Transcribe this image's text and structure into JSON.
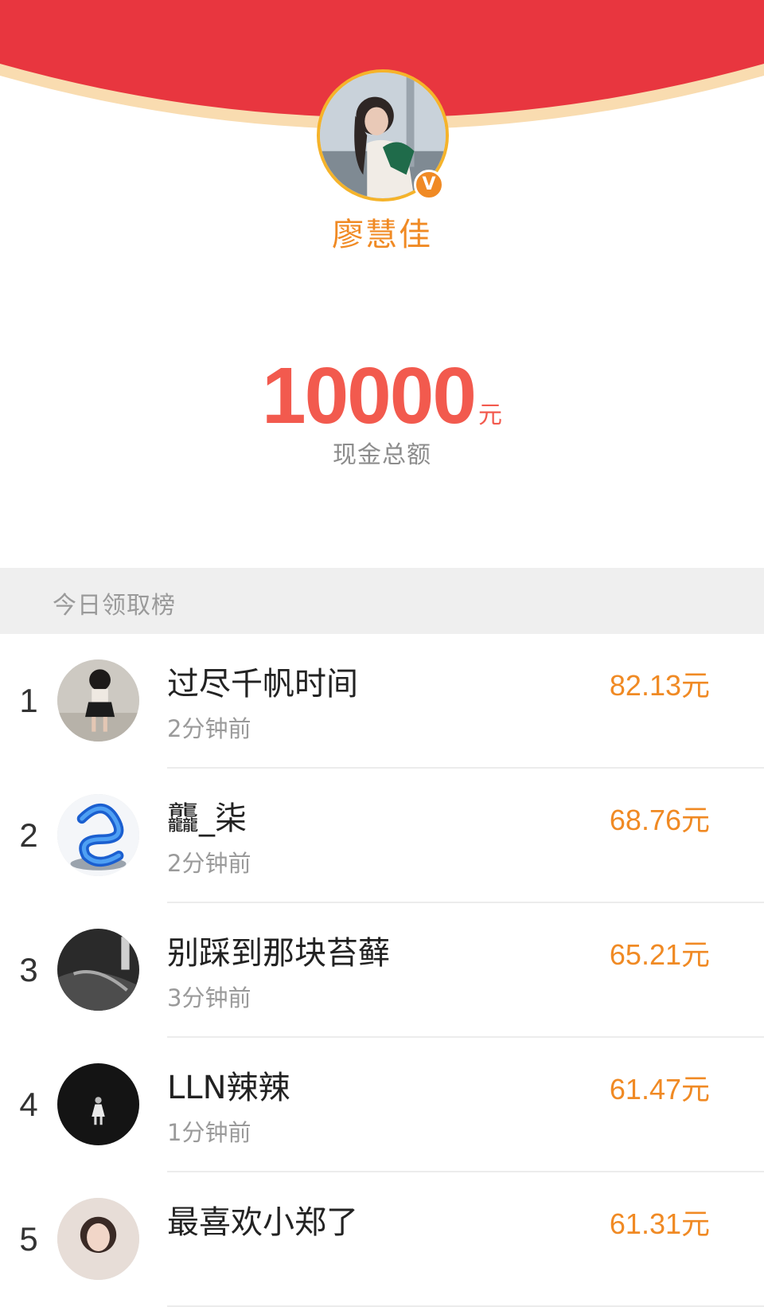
{
  "colors": {
    "header_red": "#e8363f",
    "header_rim": "#f9dcb0",
    "accent_orange": "#f08a24",
    "amount_red": "#f25a4e"
  },
  "profile": {
    "name": "廖慧佳",
    "verified_icon": "verified-v-icon",
    "verified_glyph": "V"
  },
  "summary": {
    "amount": "10000",
    "unit": "元",
    "label": "现金总额"
  },
  "leaderboard": {
    "title": "今日领取榜",
    "rows": [
      {
        "rank": "1",
        "name": "过尽千帆时间",
        "time": "2分钟前",
        "amount": "82.13元"
      },
      {
        "rank": "2",
        "name": "龘_柒",
        "time": "2分钟前",
        "amount": "68.76元"
      },
      {
        "rank": "3",
        "name": "别踩到那块苔藓",
        "time": "3分钟前",
        "amount": "65.21元"
      },
      {
        "rank": "4",
        "name": "LLN辣辣",
        "time": "1分钟前",
        "amount": "61.47元"
      },
      {
        "rank": "5",
        "name": "最喜欢小郑了",
        "time": "",
        "amount": "61.31元"
      }
    ]
  }
}
